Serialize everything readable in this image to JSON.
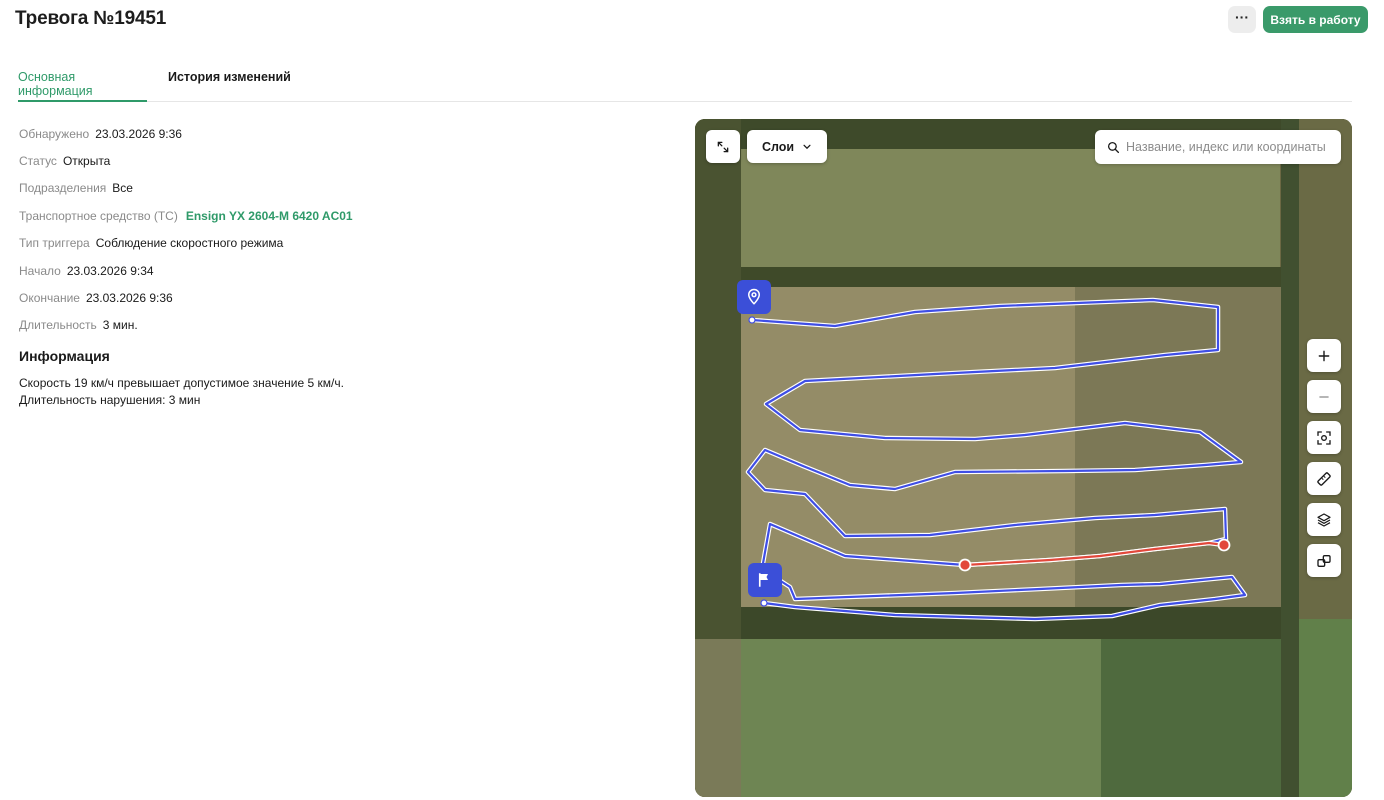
{
  "header": {
    "title": "Тревога №19451",
    "more_label": "···",
    "take_label": "Взять в работу"
  },
  "tabs": [
    {
      "label": "Основная информация",
      "active": true
    },
    {
      "label": "История изменений",
      "active": false
    }
  ],
  "details": [
    {
      "label": "Обнаружено",
      "value": "23.03.2026 9:36"
    },
    {
      "label": "Статус",
      "value": "Открыта"
    },
    {
      "label": "Подразделения",
      "value": "Все"
    },
    {
      "label": "Транспортное средство (ТС)",
      "value": "Ensign YX 2604-M 6420 AC01"
    },
    {
      "label": "Тип триггера",
      "value": "Соблюдение скоростного режима"
    },
    {
      "label": "Начало",
      "value": "23.03.2026 9:34"
    },
    {
      "label": "Окончание",
      "value": "23.03.2026 9:36"
    },
    {
      "label": "Длительность",
      "value": "3 мин."
    }
  ],
  "info_section": {
    "title": "Информация",
    "line1": "Скорость 19 км/ч превышает допустимое значение 5 км/ч.",
    "line2": "Длительность нарушения: 3 мин"
  },
  "map": {
    "layers_label": "Слои",
    "search_placeholder": "Название, индекс или координаты",
    "track_color": "#3f4ee6",
    "violation_color": "#e2483b",
    "accent": "#2f9a69",
    "tools": [
      "zoom-in-icon",
      "zoom-out-icon",
      "focus-icon",
      "ruler-icon",
      "layers-icon",
      "link-icon"
    ]
  }
}
